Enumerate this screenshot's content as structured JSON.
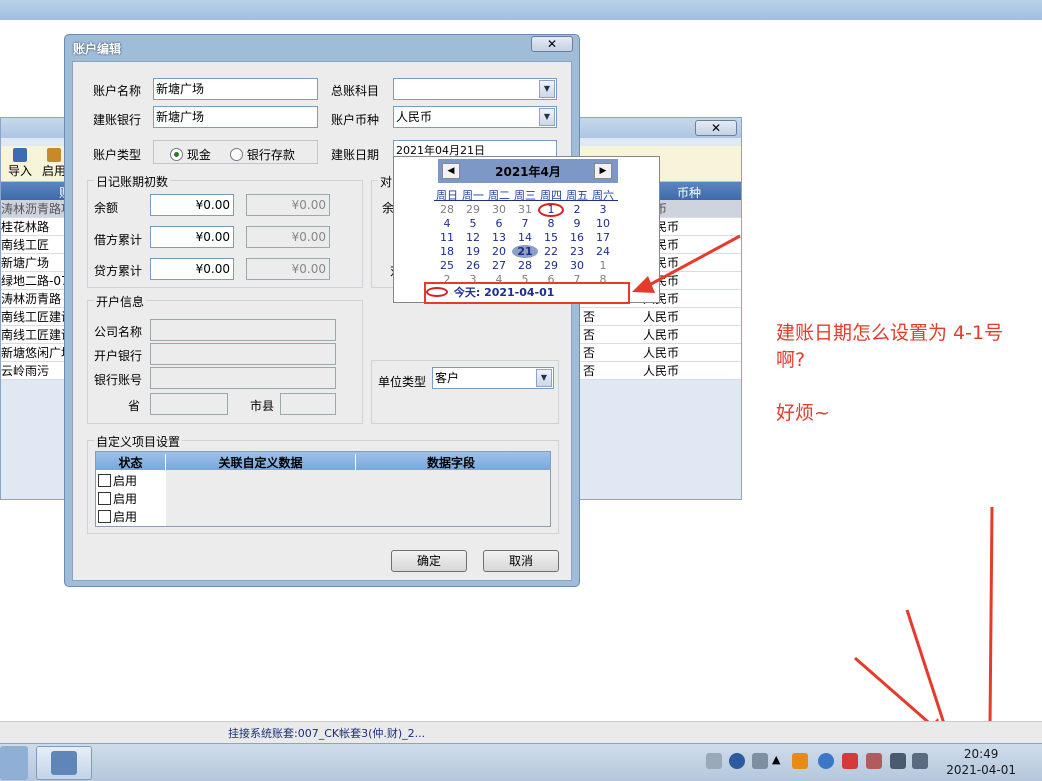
{
  "background_window": {
    "close_glyph": "✕",
    "toolbar": {
      "import_label": "导入",
      "enable_label": "启用"
    },
    "header": {
      "name_col": "账",
      "currency_col": "币种"
    },
    "rows": [
      {
        "name": "涛林沥青路项",
        "no": "",
        "currency": "民币"
      },
      {
        "name": "桂花林路",
        "no": "",
        "currency": "人民币"
      },
      {
        "name": "南线工匠",
        "no": "",
        "currency": "人民币"
      },
      {
        "name": "新塘广场",
        "no": "",
        "currency": "人民币"
      },
      {
        "name": "绿地二路-07",
        "no": "",
        "currency": "人民币"
      },
      {
        "name": "涛林沥青路",
        "no": "",
        "currency": "人民币"
      },
      {
        "name": "南线工匠建设",
        "no": "否",
        "currency": "人民币"
      },
      {
        "name": "南线工匠建设",
        "no": "否",
        "currency": "人民币"
      },
      {
        "name": "新塘悠闲广场",
        "no": "否",
        "currency": "人民币"
      },
      {
        "name": "云岭雨污",
        "no": "否",
        "currency": "人民币"
      }
    ]
  },
  "dialog": {
    "title": "账户编辑",
    "close_glyph": "✕",
    "account_name_label": "账户名称",
    "account_name_value": "新塘广场",
    "ledger_subject_label": "总账科目",
    "ledger_subject_value": "",
    "bank_label": "建账银行",
    "bank_value": "新塘广场",
    "currency_label": "账户币种",
    "currency_value": "人民币",
    "type_label": "账户类型",
    "type_cash": "现金",
    "type_bank": "银行存款",
    "date_label": "建账日期",
    "date_value": "2021年04月21日",
    "journal_group": "日记账期初数",
    "balance_label": "余额",
    "debit_label": "借方累计",
    "credit_label": "贷方累计",
    "money_zero": "¥0.00",
    "reconcile_group": "对",
    "reconcile_balance": "余",
    "reconcile_other": "对",
    "bank_group": "开户信息",
    "company_label": "公司名称",
    "open_bank_label": "开户银行",
    "bank_account_label": "银行账号",
    "province_label": "省",
    "city_label": "市县",
    "unit_type_label": "单位类型",
    "unit_type_value": "客户",
    "custom_group": "自定义项目设置",
    "grid_headers": [
      "状态",
      "关联自定义数据",
      "数据字段"
    ],
    "grid_rows": [
      "启用",
      "启用",
      "启用"
    ],
    "ok_label": "确定",
    "cancel_label": "取消"
  },
  "calendar": {
    "title": "2021年4月",
    "prev": "◀",
    "next": "▶",
    "weekdays": [
      "周日",
      "周一",
      "周二",
      "周三",
      "周四",
      "周五",
      "周六"
    ],
    "weeks": [
      [
        "28",
        "29",
        "30",
        "31",
        "1",
        "2",
        "3"
      ],
      [
        "4",
        "5",
        "6",
        "7",
        "8",
        "9",
        "10"
      ],
      [
        "11",
        "12",
        "13",
        "14",
        "15",
        "16",
        "17"
      ],
      [
        "18",
        "19",
        "20",
        "21",
        "22",
        "23",
        "24"
      ],
      [
        "25",
        "26",
        "27",
        "28",
        "29",
        "30",
        "1"
      ],
      [
        "2",
        "3",
        "4",
        "5",
        "6",
        "7",
        "8"
      ]
    ],
    "selected_day": "21",
    "circled_day": "1",
    "today_text": "今天: 2021-04-01"
  },
  "annotation": {
    "line1": "建账日期怎么设置为 4-1号",
    "line2": "啊?",
    "line3": "好烦~",
    "color": "#e53b2a"
  },
  "status_bar": {
    "text": "挂接系统账套:007_CK帐套3(仲.财)_2..."
  },
  "taskbar": {
    "time": "20:49",
    "date": "2021-04-01"
  }
}
